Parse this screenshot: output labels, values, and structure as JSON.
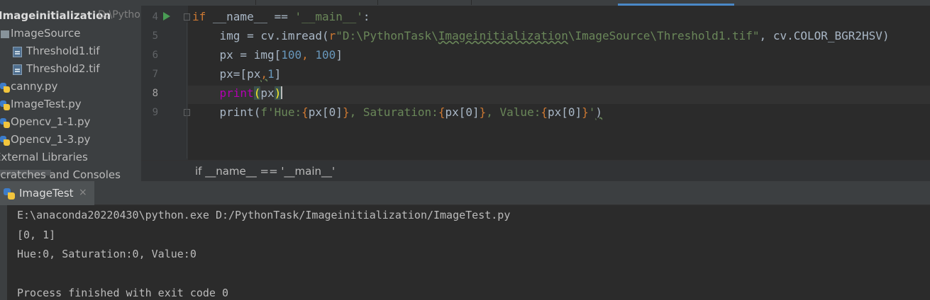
{
  "project": {
    "root_name": "Imageinitialization",
    "root_path": "D:\\Pytho",
    "items": [
      {
        "label": "ImageSource",
        "type": "folder"
      },
      {
        "label": "Threshold1.tif",
        "type": "file"
      },
      {
        "label": "Threshold2.tif",
        "type": "file"
      },
      {
        "label": "canny.py",
        "type": "python"
      },
      {
        "label": "ImageTest.py",
        "type": "python"
      },
      {
        "label": "Opencv_1-1.py",
        "type": "python"
      },
      {
        "label": "Opencv_1-3.py",
        "type": "python"
      },
      {
        "label": "External Libraries",
        "type": "node"
      },
      {
        "label": "Scratches and Consoles",
        "type": "node"
      }
    ]
  },
  "editor": {
    "line_numbers": [
      "4",
      "5",
      "6",
      "7",
      "8",
      "9"
    ],
    "current_line": "8",
    "lines": {
      "l4": {
        "kw": "if",
        "a": " __name__ == ",
        "s": "'__main__'",
        "b": ":"
      },
      "l5": {
        "a": "    img = cv.imread(",
        "p": "r",
        "s1": "\"D:\\PythonTask\\",
        "u": "Imageinitialization",
        "s2": "\\ImageSource\\Threshold1.tif\"",
        "b": ", cv.COLOR_BGR2HSV)"
      },
      "l6": {
        "a": "    px = img[",
        "n1": "100",
        "c": ", ",
        "n2": "100",
        "b": "]"
      },
      "l7": {
        "a": "    px=[px",
        "c": ",",
        "n": "1",
        "b": "]"
      },
      "l8": {
        "fn": "print",
        "o": "(",
        "a": "px",
        "cl": ")"
      },
      "l9": {
        "a": "    print(",
        "f": "f'Hue:",
        "o1": "{",
        "e1": "px[0]",
        "c1": "}",
        "s1": ", Saturation:",
        "o2": "{",
        "e2": "px[0]",
        "c2": "}",
        "s2": ", Value:",
        "o3": "{",
        "e3": "px[0]",
        "c3": "}",
        "q": "'",
        "b": ")"
      }
    }
  },
  "breadcrumb": "if __name__ == '__main__'",
  "run": {
    "tab_label": "ImageTest",
    "close_glyph": "×",
    "output": [
      "E:\\anaconda20220430\\python.exe D:/PythonTask/Imageinitialization/ImageTest.py",
      "[0, 1]",
      "Hue:0, Saturation:0, Value:0",
      "",
      "Process finished with exit code 0"
    ]
  },
  "colors": {
    "keyword": "#cc7832",
    "string": "#6a8759",
    "number": "#6897bb",
    "builtin": "#b200b2",
    "active_tab": "#4a88c7"
  },
  "icons": {
    "run": "run-arrow-icon",
    "folder": "folder-icon",
    "file": "tif-file-icon",
    "python": "python-file-icon"
  }
}
